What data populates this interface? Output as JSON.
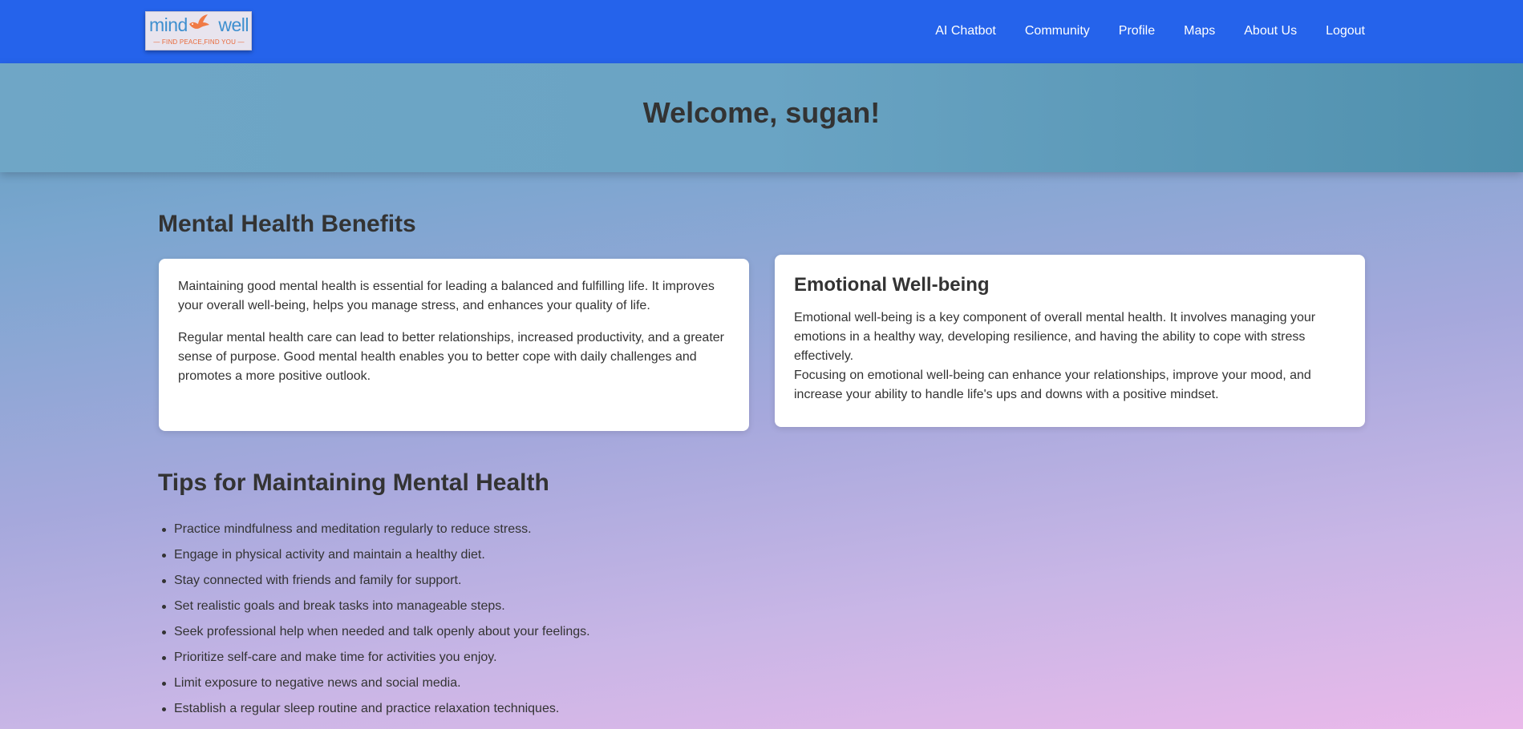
{
  "header": {
    "logo": {
      "word1": "mind",
      "word2": "well",
      "tagline": "— FIND PEACE,FIND YOU —",
      "icon": "bird-icon"
    },
    "nav": [
      {
        "label": "AI Chatbot"
      },
      {
        "label": "Community"
      },
      {
        "label": "Profile"
      },
      {
        "label": "Maps"
      },
      {
        "label": "About Us"
      },
      {
        "label": "Logout"
      }
    ],
    "bg_color": "#2563eb"
  },
  "hero": {
    "title": "Welcome, sugan!"
  },
  "benefits": {
    "title": "Mental Health Benefits",
    "card1": {
      "p1": "Maintaining good mental health is essential for leading a balanced and fulfilling life. It improves your overall well-being, helps you manage stress, and enhances your quality of life.",
      "p2": "Regular mental health care can lead to better relationships, increased productivity, and a greater sense of purpose. Good mental health enables you to better cope with daily challenges and promotes a more positive outlook."
    },
    "card2": {
      "title": "Emotional Well-being",
      "p1": "Emotional well-being is a key component of overall mental health. It involves managing your emotions in a healthy way, developing resilience, and having the ability to cope with stress effectively.",
      "p2": "Focusing on emotional well-being can enhance your relationships, improve your mood, and increase your ability to handle life's ups and downs with a positive mindset."
    }
  },
  "tips": {
    "title": "Tips for Maintaining Mental Health",
    "items": [
      "Practice mindfulness and meditation regularly to reduce stress.",
      "Engage in physical activity and maintain a healthy diet.",
      "Stay connected with friends and family for support.",
      "Set realistic goals and break tasks into manageable steps.",
      "Seek professional help when needed and talk openly about your feelings.",
      "Prioritize self-care and make time for activities you enjoy.",
      "Limit exposure to negative news and social media.",
      "Establish a regular sleep routine and practice relaxation techniques."
    ]
  }
}
